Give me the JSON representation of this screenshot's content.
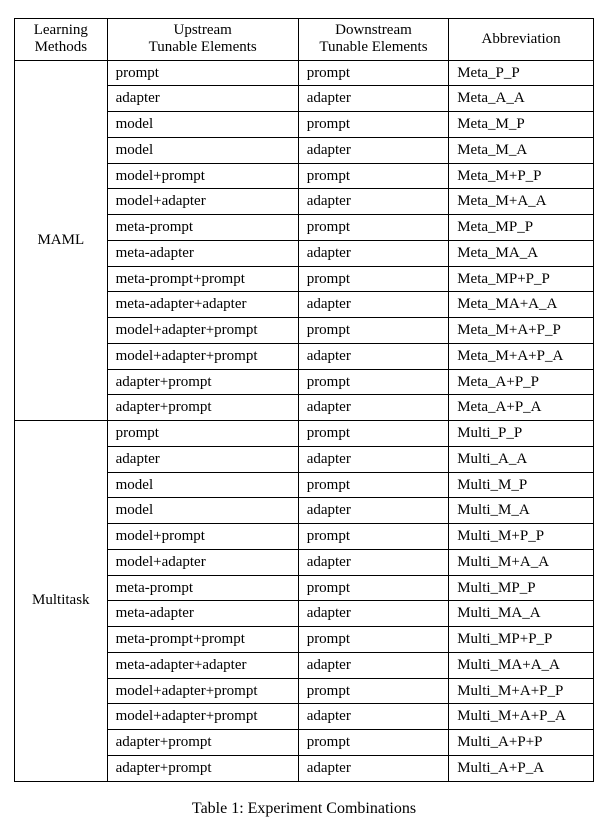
{
  "header": {
    "col1a": "Learning",
    "col1b": "Methods",
    "col2a": "Upstream",
    "col2b": "Tunable Elements",
    "col3a": "Downstream",
    "col3b": "Tunable Elements",
    "col4": "Abbreviation"
  },
  "groups": [
    {
      "method": "MAML",
      "rows": [
        {
          "up": "prompt",
          "down": "prompt",
          "abbr": "Meta_P_P"
        },
        {
          "up": "adapter",
          "down": "adapter",
          "abbr": "Meta_A_A"
        },
        {
          "up": "model",
          "down": "prompt",
          "abbr": "Meta_M_P"
        },
        {
          "up": "model",
          "down": "adapter",
          "abbr": "Meta_M_A"
        },
        {
          "up": "model+prompt",
          "down": "prompt",
          "abbr": "Meta_M+P_P"
        },
        {
          "up": "model+adapter",
          "down": "adapter",
          "abbr": "Meta_M+A_A"
        },
        {
          "up": "meta-prompt",
          "down": "prompt",
          "abbr": "Meta_MP_P"
        },
        {
          "up": "meta-adapter",
          "down": "adapter",
          "abbr": "Meta_MA_A"
        },
        {
          "up": "meta-prompt+prompt",
          "down": "prompt",
          "abbr": "Meta_MP+P_P"
        },
        {
          "up": "meta-adapter+adapter",
          "down": "adapter",
          "abbr": "Meta_MA+A_A"
        },
        {
          "up": "model+adapter+prompt",
          "down": "prompt",
          "abbr": "Meta_M+A+P_P"
        },
        {
          "up": "model+adapter+prompt",
          "down": "adapter",
          "abbr": "Meta_M+A+P_A"
        },
        {
          "up": "adapter+prompt",
          "down": "prompt",
          "abbr": "Meta_A+P_P"
        },
        {
          "up": "adapter+prompt",
          "down": "adapter",
          "abbr": "Meta_A+P_A"
        }
      ]
    },
    {
      "method": "Multitask",
      "rows": [
        {
          "up": "prompt",
          "down": "prompt",
          "abbr": "Multi_P_P"
        },
        {
          "up": "adapter",
          "down": "adapter",
          "abbr": "Multi_A_A"
        },
        {
          "up": "model",
          "down": "prompt",
          "abbr": "Multi_M_P"
        },
        {
          "up": "model",
          "down": "adapter",
          "abbr": "Multi_M_A"
        },
        {
          "up": "model+prompt",
          "down": "prompt",
          "abbr": "Multi_M+P_P"
        },
        {
          "up": "model+adapter",
          "down": "adapter",
          "abbr": "Multi_M+A_A"
        },
        {
          "up": "meta-prompt",
          "down": "prompt",
          "abbr": "Multi_MP_P"
        },
        {
          "up": "meta-adapter",
          "down": "adapter",
          "abbr": "Multi_MA_A"
        },
        {
          "up": "meta-prompt+prompt",
          "down": "prompt",
          "abbr": "Multi_MP+P_P"
        },
        {
          "up": "meta-adapter+adapter",
          "down": "adapter",
          "abbr": "Multi_MA+A_A"
        },
        {
          "up": "model+adapter+prompt",
          "down": "prompt",
          "abbr": "Multi_M+A+P_P"
        },
        {
          "up": "model+adapter+prompt",
          "down": "adapter",
          "abbr": "Multi_M+A+P_A"
        },
        {
          "up": "adapter+prompt",
          "down": "prompt",
          "abbr": "Multi_A+P+P"
        },
        {
          "up": "adapter+prompt",
          "down": "adapter",
          "abbr": "Multi_A+P_A"
        }
      ]
    }
  ],
  "caption": "Table 1: Experiment Combinations",
  "chart_data": {
    "type": "table",
    "title": "Experiment Combinations",
    "columns": [
      "Learning Methods",
      "Upstream Tunable Elements",
      "Downstream Tunable Elements",
      "Abbreviation"
    ],
    "rows": [
      [
        "MAML",
        "prompt",
        "prompt",
        "Meta_P_P"
      ],
      [
        "MAML",
        "adapter",
        "adapter",
        "Meta_A_A"
      ],
      [
        "MAML",
        "model",
        "prompt",
        "Meta_M_P"
      ],
      [
        "MAML",
        "model",
        "adapter",
        "Meta_M_A"
      ],
      [
        "MAML",
        "model+prompt",
        "prompt",
        "Meta_M+P_P"
      ],
      [
        "MAML",
        "model+adapter",
        "adapter",
        "Meta_M+A_A"
      ],
      [
        "MAML",
        "meta-prompt",
        "prompt",
        "Meta_MP_P"
      ],
      [
        "MAML",
        "meta-adapter",
        "adapter",
        "Meta_MA_A"
      ],
      [
        "MAML",
        "meta-prompt+prompt",
        "prompt",
        "Meta_MP+P_P"
      ],
      [
        "MAML",
        "meta-adapter+adapter",
        "adapter",
        "Meta_MA+A_A"
      ],
      [
        "MAML",
        "model+adapter+prompt",
        "prompt",
        "Meta_M+A+P_P"
      ],
      [
        "MAML",
        "model+adapter+prompt",
        "adapter",
        "Meta_M+A+P_A"
      ],
      [
        "MAML",
        "adapter+prompt",
        "prompt",
        "Meta_A+P_P"
      ],
      [
        "MAML",
        "adapter+prompt",
        "adapter",
        "Meta_A+P_A"
      ],
      [
        "Multitask",
        "prompt",
        "prompt",
        "Multi_P_P"
      ],
      [
        "Multitask",
        "adapter",
        "adapter",
        "Multi_A_A"
      ],
      [
        "Multitask",
        "model",
        "prompt",
        "Multi_M_P"
      ],
      [
        "Multitask",
        "model",
        "adapter",
        "Multi_M_A"
      ],
      [
        "Multitask",
        "model+prompt",
        "prompt",
        "Multi_M+P_P"
      ],
      [
        "Multitask",
        "model+adapter",
        "adapter",
        "Multi_M+A_A"
      ],
      [
        "Multitask",
        "meta-prompt",
        "prompt",
        "Multi_MP_P"
      ],
      [
        "Multitask",
        "meta-adapter",
        "adapter",
        "Multi_MA_A"
      ],
      [
        "Multitask",
        "meta-prompt+prompt",
        "prompt",
        "Multi_MP+P_P"
      ],
      [
        "Multitask",
        "meta-adapter+adapter",
        "adapter",
        "Multi_MA+A_A"
      ],
      [
        "Multitask",
        "model+adapter+prompt",
        "prompt",
        "Multi_M+A+P_P"
      ],
      [
        "Multitask",
        "model+adapter+prompt",
        "adapter",
        "Multi_M+A+P_A"
      ],
      [
        "Multitask",
        "adapter+prompt",
        "prompt",
        "Multi_A+P+P"
      ],
      [
        "Multitask",
        "adapter+prompt",
        "adapter",
        "Multi_A+P_A"
      ]
    ]
  }
}
